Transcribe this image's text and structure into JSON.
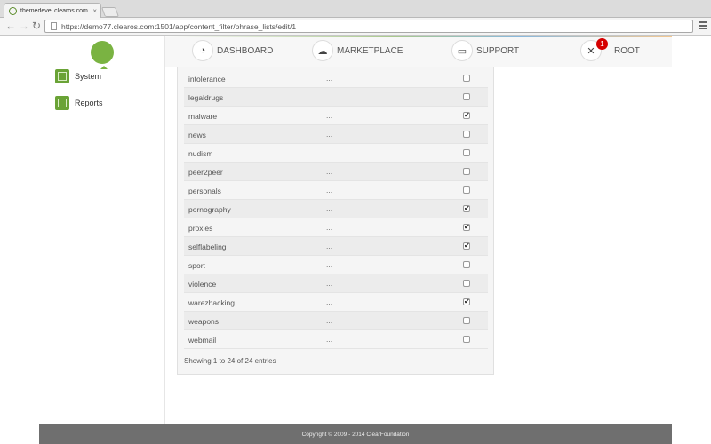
{
  "browser": {
    "tab_title": "themedevel.clearos.com",
    "tab_close": "×",
    "url": "https://demo77.clearos.com:1501/app/content_filter/phrase_lists/edit/1",
    "back_glyph": "←",
    "forward_glyph": "→",
    "reload_glyph": "↻"
  },
  "sidebar": {
    "items": [
      {
        "label": "System",
        "icon": "cube-icon"
      },
      {
        "label": "Reports",
        "icon": "cube-icon"
      }
    ]
  },
  "topnav": {
    "items": [
      {
        "label": "DASHBOARD",
        "icon": "gauge-icon",
        "glyph": "◔"
      },
      {
        "label": "MARKETPLACE",
        "icon": "cloud-download-icon",
        "glyph": "☁"
      },
      {
        "label": "SUPPORT",
        "icon": "inbox-icon",
        "glyph": "▭"
      },
      {
        "label": "ROOT",
        "icon": "tools-icon",
        "glyph": "✕",
        "badge": "1"
      }
    ]
  },
  "table": {
    "rows": [
      {
        "name": "intolerance",
        "description": "...",
        "checked": false
      },
      {
        "name": "legaldrugs",
        "description": "...",
        "checked": false
      },
      {
        "name": "malware",
        "description": "...",
        "checked": true
      },
      {
        "name": "news",
        "description": "...",
        "checked": false
      },
      {
        "name": "nudism",
        "description": "...",
        "checked": false
      },
      {
        "name": "peer2peer",
        "description": "...",
        "checked": false
      },
      {
        "name": "personals",
        "description": "...",
        "checked": false
      },
      {
        "name": "pornography",
        "description": "...",
        "checked": true
      },
      {
        "name": "proxies",
        "description": "...",
        "checked": true
      },
      {
        "name": "selflabeling",
        "description": "...",
        "checked": true
      },
      {
        "name": "sport",
        "description": "...",
        "checked": false
      },
      {
        "name": "violence",
        "description": "...",
        "checked": false
      },
      {
        "name": "warezhacking",
        "description": "...",
        "checked": true
      },
      {
        "name": "weapons",
        "description": "...",
        "checked": false
      },
      {
        "name": "webmail",
        "description": "...",
        "checked": false
      }
    ],
    "summary": "Showing 1 to 24 of 24 entries",
    "check_glyph": "✔"
  },
  "footer": {
    "text": "Copyright © 2009 - 2014 ClearFoundation"
  },
  "colors": {
    "brand_green": "#7ab342",
    "badge_red": "#d60000",
    "footer_gray": "#6f6f6f"
  }
}
